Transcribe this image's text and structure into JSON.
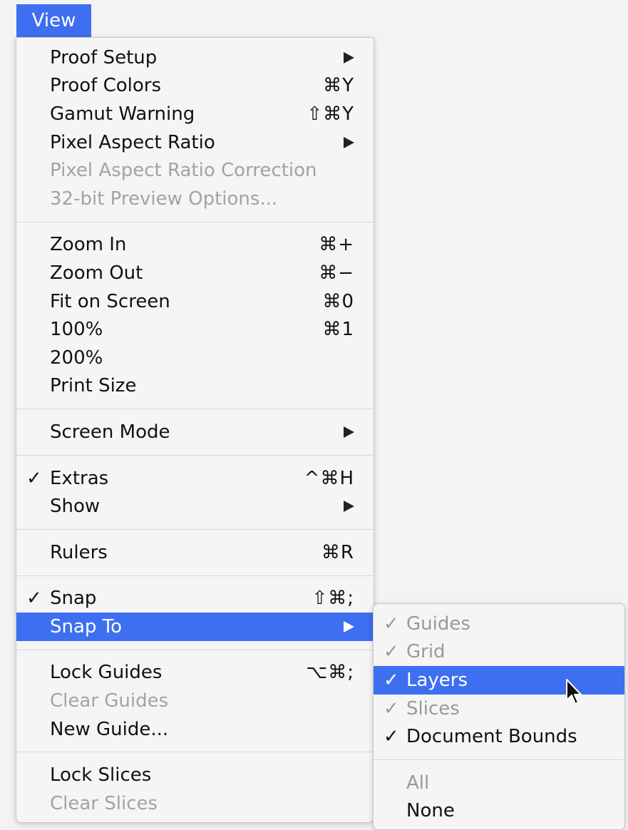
{
  "menubar": {
    "title": "View"
  },
  "menu": {
    "groups": [
      [
        {
          "label": "Proof Setup",
          "arrow": true
        },
        {
          "label": "Proof Colors",
          "shortcut": "⌘Y"
        },
        {
          "label": "Gamut Warning",
          "shortcut": "⇧⌘Y"
        },
        {
          "label": "Pixel Aspect Ratio",
          "arrow": true
        },
        {
          "label": "Pixel Aspect Ratio Correction",
          "disabled": true
        },
        {
          "label": "32-bit Preview Options...",
          "disabled": true
        }
      ],
      [
        {
          "label": "Zoom In",
          "shortcut": "⌘+"
        },
        {
          "label": "Zoom Out",
          "shortcut": "⌘−"
        },
        {
          "label": "Fit on Screen",
          "shortcut": "⌘0"
        },
        {
          "label": "100%",
          "shortcut": "⌘1"
        },
        {
          "label": "200%"
        },
        {
          "label": "Print Size"
        }
      ],
      [
        {
          "label": "Screen Mode",
          "arrow": true
        }
      ],
      [
        {
          "label": "Extras",
          "shortcut": "^⌘H",
          "checked": true
        },
        {
          "label": "Show",
          "arrow": true
        }
      ],
      [
        {
          "label": "Rulers",
          "shortcut": "⌘R"
        }
      ],
      [
        {
          "label": "Snap",
          "shortcut": "⇧⌘;",
          "checked": true
        },
        {
          "label": "Snap To",
          "arrow": true,
          "highlighted": true
        }
      ],
      [
        {
          "label": "Lock Guides",
          "shortcut": "⌥⌘;"
        },
        {
          "label": "Clear Guides",
          "disabled": true
        },
        {
          "label": "New Guide..."
        }
      ],
      [
        {
          "label": "Lock Slices"
        },
        {
          "label": "Clear Slices",
          "disabled": true
        }
      ]
    ]
  },
  "submenu": {
    "groups": [
      [
        {
          "label": "Guides",
          "checked": true,
          "gray_check": true,
          "gray_label": true
        },
        {
          "label": "Grid",
          "checked": true,
          "gray_check": true,
          "gray_label": true
        },
        {
          "label": "Layers",
          "checked": true,
          "highlighted": true
        },
        {
          "label": "Slices",
          "checked": true,
          "gray_check": true,
          "gray_label": true
        },
        {
          "label": "Document Bounds",
          "checked": true
        }
      ],
      [
        {
          "label": "All",
          "gray_label": true
        },
        {
          "label": "None"
        }
      ]
    ]
  },
  "glyphs": {
    "check": "✓"
  },
  "colors": {
    "accent": "#3d6ff0",
    "disabled": "#a3a3a3"
  }
}
